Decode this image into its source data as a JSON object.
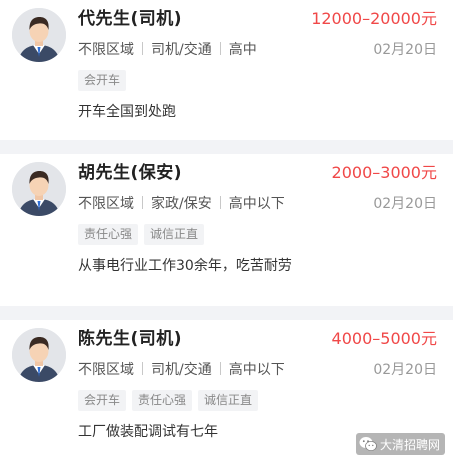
{
  "listings": [
    {
      "name": "代先生(司机)",
      "salary": "12000–20000元",
      "location": "不限区域",
      "category": "司机/交通",
      "education": "高中",
      "date": "02月20日",
      "tags": [
        "会开车"
      ],
      "description": "开车全国到处跑"
    },
    {
      "name": "胡先生(保安)",
      "salary": "2000–3000元",
      "location": "不限区域",
      "category": "家政/保安",
      "education": "高中以下",
      "date": "02月20日",
      "tags": [
        "责任心强",
        "诚信正直"
      ],
      "description": "从事电行业工作30余年，吃苦耐劳"
    },
    {
      "name": "陈先生(司机)",
      "salary": "4000–5000元",
      "location": "不限区域",
      "category": "司机/交通",
      "education": "高中以下",
      "date": "02月20日",
      "tags": [
        "会开车",
        "责任心强",
        "诚信正直"
      ],
      "description": "工厂做装配调试有七年"
    }
  ],
  "watermark": {
    "text": "大清招聘网",
    "icon": "wechat-icon"
  },
  "colors": {
    "salary": "#f04848",
    "background": "#f2f3f6",
    "card": "#ffffff",
    "tag_bg": "#f2f3f5"
  }
}
